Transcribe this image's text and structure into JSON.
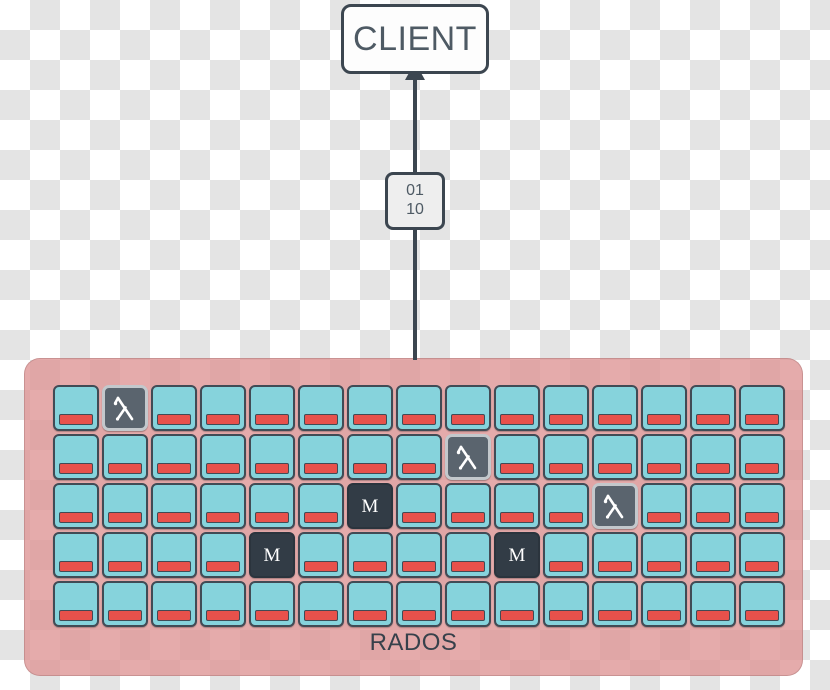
{
  "client": {
    "label": "CLIENT"
  },
  "connector": {
    "direction": "up",
    "arrow_color": "#3c4650"
  },
  "data_packet": {
    "line1": "01",
    "line2": "10"
  },
  "cluster": {
    "label": "RADOS",
    "rows": 5,
    "columns": 15,
    "colors": {
      "container": "#DE9696",
      "osd_fill": "#86d3dc",
      "osd_bar": "#e8514b",
      "monitor_fill": "#323c46",
      "mds_fill": "#5a646e",
      "outline": "#414b55"
    },
    "legend": {
      "osd": "osd-node",
      "monitor": "monitor-node",
      "mds": "mds-node"
    },
    "monitor_glyph": "M",
    "grid": [
      [
        "osd",
        "mds",
        "osd",
        "osd",
        "osd",
        "osd",
        "osd",
        "osd",
        "osd",
        "osd",
        "osd",
        "osd",
        "osd",
        "osd",
        "osd"
      ],
      [
        "osd",
        "osd",
        "osd",
        "osd",
        "osd",
        "osd",
        "osd",
        "osd",
        "mds",
        "osd",
        "osd",
        "osd",
        "osd",
        "osd",
        "osd"
      ],
      [
        "osd",
        "osd",
        "osd",
        "osd",
        "osd",
        "osd",
        "mon",
        "osd",
        "osd",
        "osd",
        "osd",
        "mds",
        "osd",
        "osd",
        "osd"
      ],
      [
        "osd",
        "osd",
        "osd",
        "osd",
        "mon",
        "osd",
        "osd",
        "osd",
        "osd",
        "mon",
        "osd",
        "osd",
        "osd",
        "osd",
        "osd"
      ],
      [
        "osd",
        "osd",
        "osd",
        "osd",
        "osd",
        "osd",
        "osd",
        "osd",
        "osd",
        "osd",
        "osd",
        "osd",
        "osd",
        "osd",
        "osd"
      ]
    ]
  }
}
